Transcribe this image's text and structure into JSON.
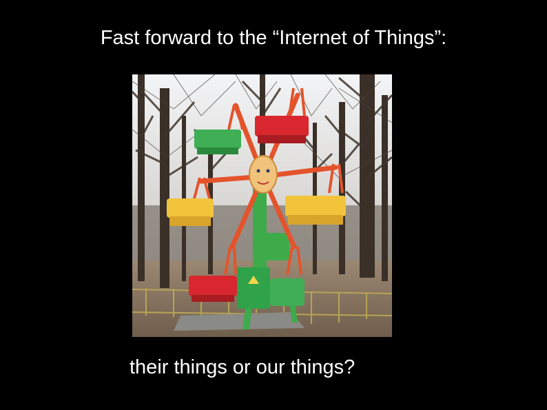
{
  "slide": {
    "title": "Fast forward to the “Internet of Things”:",
    "caption": "their things or our things?"
  },
  "photo": {
    "subject": "ferris-wheel",
    "colors": {
      "sky": "#e9ecef",
      "ground": "#8d7a66",
      "frame": "#e4532b",
      "support": "#3dab4a",
      "gondola_red": "#d8272f",
      "gondola_green": "#3fae55",
      "gondola_yellow": "#f2c43c",
      "face": "#f0c27a"
    }
  }
}
